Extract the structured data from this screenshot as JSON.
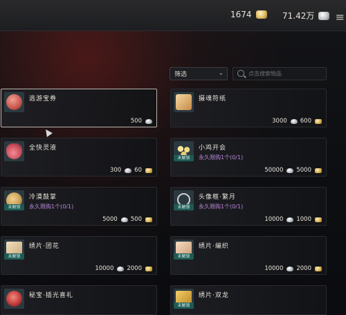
{
  "topbar": {
    "gold_amount": "1674",
    "silver_amount": "71.42万",
    "menu_glyph": "≡"
  },
  "filter": {
    "label": "筛选",
    "chevron": "⌄"
  },
  "search": {
    "placeholder": "点击搜索物品"
  },
  "items": [
    {
      "name": "逃游宝券",
      "limit": "",
      "tag": "",
      "silver": "",
      "coin": "500",
      "coin_type": "silver",
      "art": "#c8554e"
    },
    {
      "name": "摄魂符纸",
      "limit": "",
      "tag": "",
      "silver": "3000",
      "coin": "600",
      "coin_type": "gold",
      "art": "#d39a5a"
    },
    {
      "name": "全快灵液",
      "limit": "",
      "tag": "",
      "silver": "300",
      "coin": "60",
      "coin_type": "gold",
      "art": "#c94c57"
    },
    {
      "name": "小鸡开会",
      "limit": "永久限购1个(0/1)",
      "tag": "未解锁",
      "silver": "50000",
      "coin": "5000",
      "coin_type": "gold",
      "art": "#cdbb6d"
    },
    {
      "name": "冷漠鼓掌",
      "limit": "永久限购1个(0/1)",
      "tag": "未解锁",
      "silver": "5000",
      "coin": "500",
      "coin_type": "gold",
      "art": "#caa25a"
    },
    {
      "name": "头像框·繁月",
      "limit": "永久限购1个(0/1)",
      "tag": "未解锁",
      "silver": "10000",
      "coin": "1000",
      "coin_type": "gold",
      "art": "#c7c7c9"
    },
    {
      "name": "绣片·团花",
      "limit": "",
      "tag": "未解锁",
      "silver": "10000",
      "coin": "2000",
      "coin_type": "gold",
      "art": "#d8c09a"
    },
    {
      "name": "绣片·编织",
      "limit": "",
      "tag": "未解锁",
      "silver": "10000",
      "coin": "2000",
      "coin_type": "gold",
      "art": "#e0c4a4"
    },
    {
      "name": "秘宝·插光喜礼",
      "limit": "",
      "tag": "",
      "silver": "",
      "coin": "",
      "coin_type": "gold",
      "art": "#c23b3b"
    },
    {
      "name": "绣片·双龙",
      "limit": "",
      "tag": "未解锁",
      "silver": "",
      "coin": "",
      "coin_type": "gold",
      "art": "#d6a93a"
    }
  ]
}
